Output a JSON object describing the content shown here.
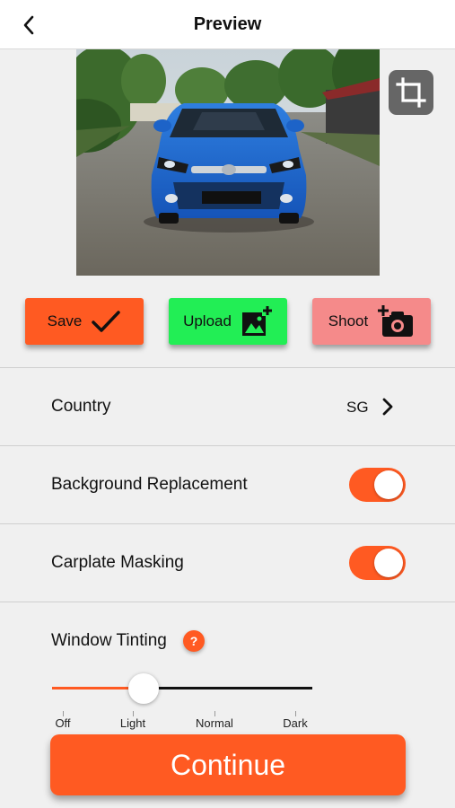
{
  "header": {
    "title": "Preview",
    "back_icon": "chevron-left-icon"
  },
  "preview": {
    "crop_icon": "crop-icon"
  },
  "actions": {
    "save": {
      "label": "Save",
      "icon": "checkmark-icon",
      "color": "#ff5a22"
    },
    "upload": {
      "label": "Upload",
      "icon": "add-image-icon",
      "color": "#22ee55"
    },
    "shoot": {
      "label": "Shoot",
      "icon": "add-camera-icon",
      "color": "#f58a8a"
    }
  },
  "settings": {
    "country": {
      "label": "Country",
      "value": "SG"
    },
    "background_replacement": {
      "label": "Background Replacement",
      "enabled": true
    },
    "carplate_masking": {
      "label": "Carplate Masking",
      "enabled": true
    },
    "window_tinting": {
      "label": "Window Tinting",
      "help": "?",
      "options": [
        "Off",
        "Light",
        "Normal",
        "Dark"
      ],
      "selected": "Light"
    }
  },
  "continue": {
    "label": "Continue"
  },
  "colors": {
    "accent": "#ff5a22",
    "toggle_on": "#ff5a22"
  }
}
